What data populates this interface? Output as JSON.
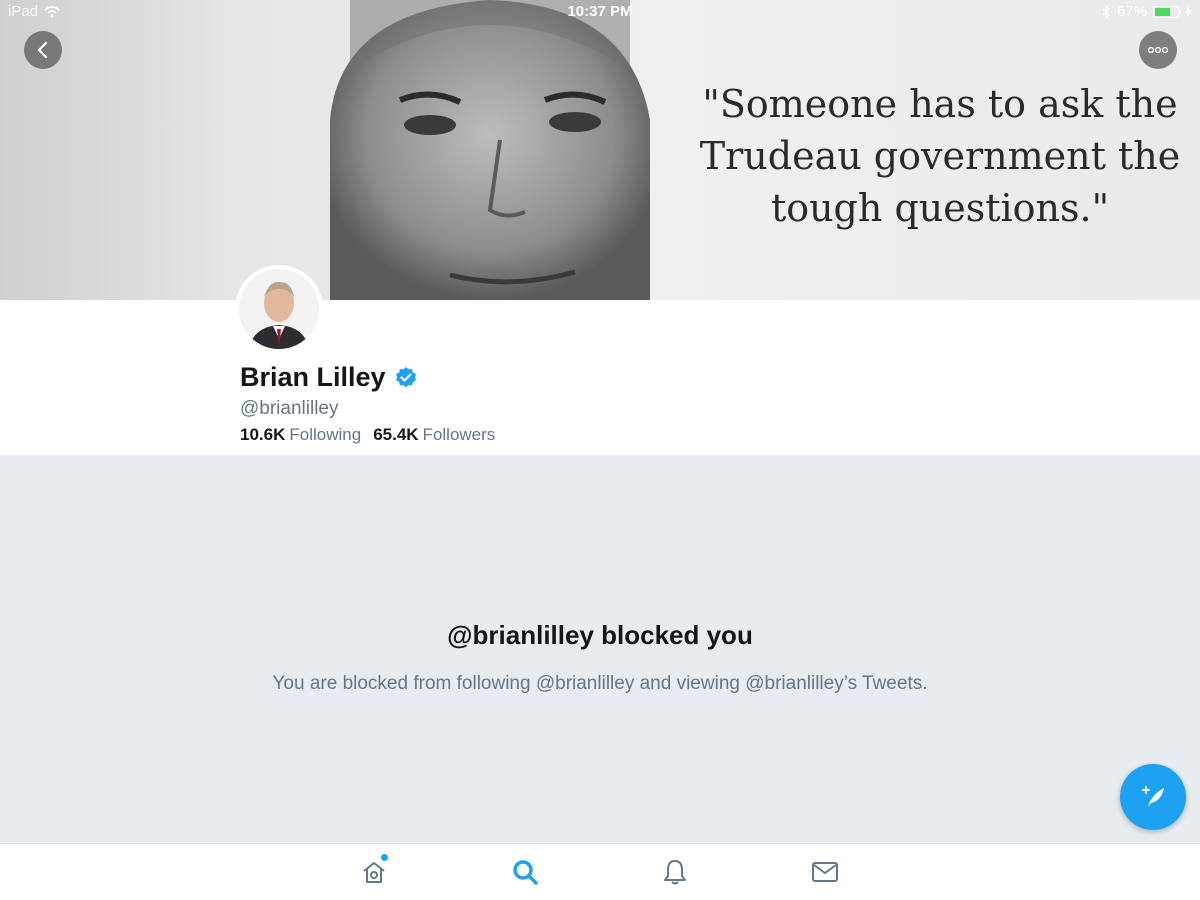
{
  "status_bar": {
    "device": "iPad",
    "time": "10:37 PM",
    "battery": "67%",
    "battery_level": 0.67
  },
  "banner": {
    "quote_lines": [
      "\"Someone has to ask the",
      "Trudeau government the",
      "tough questions.\""
    ]
  },
  "profile": {
    "name": "Brian Lilley",
    "handle": "@brianlilley",
    "following_count": "10.6K",
    "following_label": "Following",
    "followers_count": "65.4K",
    "followers_label": "Followers"
  },
  "blocked": {
    "title": "@brianlilley blocked you",
    "message": "You are blocked from following @brianlilley and viewing @brianlilley’s Tweets."
  },
  "tabbar": {
    "items": [
      "home-icon",
      "search-icon",
      "notifications-icon",
      "messages-icon"
    ],
    "active": "search-icon"
  },
  "colors": {
    "accent": "#1da1f2",
    "muted_text": "#657786",
    "blocked_bg": "#e6ecf0"
  }
}
